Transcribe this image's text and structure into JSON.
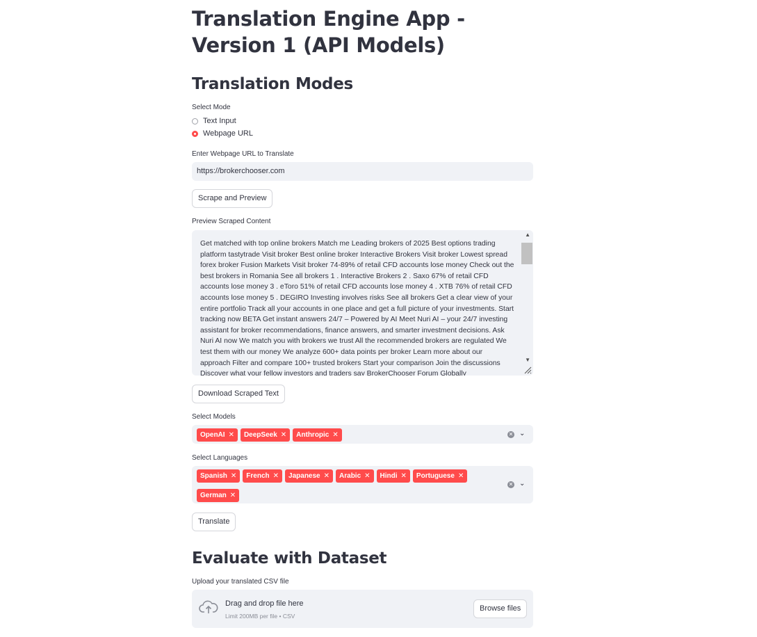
{
  "page": {
    "title": "Translation Engine App - Version 1 (API Models)"
  },
  "modes": {
    "heading": "Translation Modes",
    "select_label": "Select Mode",
    "options": [
      "Text Input",
      "Webpage URL"
    ],
    "selected": "Webpage URL"
  },
  "url": {
    "label": "Enter Webpage URL to Translate",
    "value": "https://brokerchooser.com"
  },
  "scrape_button": "Scrape and Preview",
  "preview": {
    "label": "Preview Scraped Content",
    "text": "Get matched with top online brokers Match me Leading brokers of 2025 Best options trading platform tastytrade Visit broker Best online broker Interactive Brokers Visit broker Lowest spread forex broker Fusion Markets Visit broker 74-89% of retail CFD accounts lose money Check out the best brokers in Romania See all brokers 1 . Interactive Brokers 2 . Saxo 67% of retail CFD accounts lose money 3 . eToro 51% of retail CFD accounts lose money 4 . XTB 76% of retail CFD accounts lose money 5 . DEGIRO Investing involves risks See all brokers Get a clear view of your entire portfolio Track all your accounts in one place and get a full picture of your investments. Start tracking now BETA Get instant answers 24/7 – Powered by AI Meet Nuri AI – your 24/7 investing assistant for broker recommendations, finance answers, and smarter investment decisions. Ask Nuri AI now We match you with brokers we trust All the recommended brokers are regulated We test them with our money We analyze 600+ data points per broker Learn more about our approach Filter and compare 100+ trusted brokers Start your comparison Join the discussions Discover what your fellow investors and traders say BrokerChooser Forum Globally"
  },
  "download_button": "Download Scraped Text",
  "models": {
    "label": "Select Models",
    "tags": [
      "OpenAI",
      "DeepSeek",
      "Anthropic"
    ]
  },
  "languages": {
    "label": "Select Languages",
    "tags": [
      "Spanish",
      "French",
      "Japanese",
      "Arabic",
      "Hindi",
      "Portuguese",
      "German"
    ]
  },
  "translate_button": "Translate",
  "evaluate": {
    "heading": "Evaluate with Dataset",
    "upload_label": "Upload your translated CSV file",
    "drop_text": "Drag and drop file here",
    "limit_text": "Limit 200MB per file • CSV",
    "browse_button": "Browse files"
  },
  "colors": {
    "accent": "#ff4b4b",
    "input_bg": "#f0f2f6",
    "text": "#31333f"
  }
}
